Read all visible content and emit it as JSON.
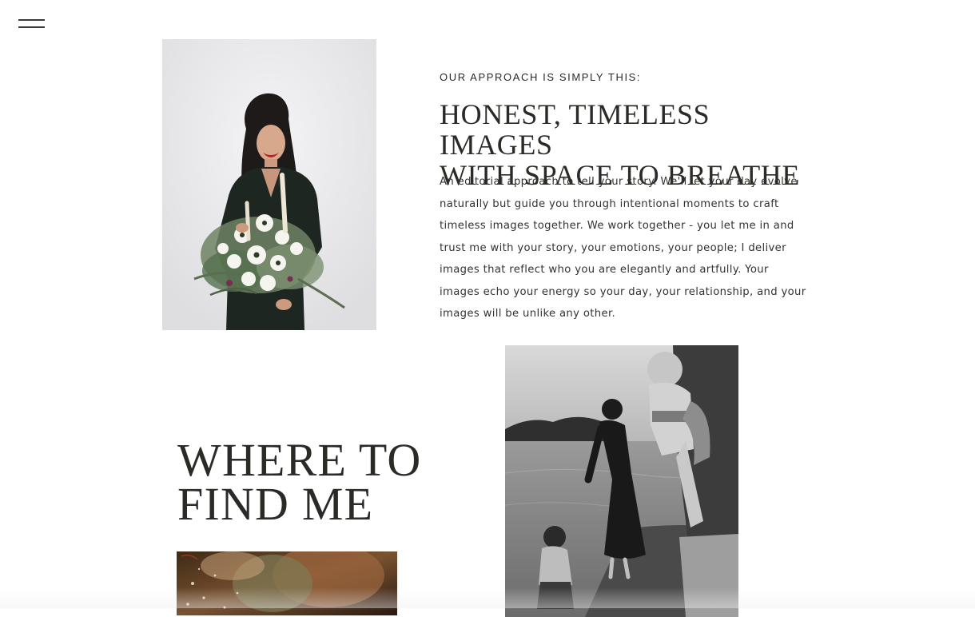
{
  "nav": {
    "menu_icon": "hamburger-menu-icon"
  },
  "approach": {
    "eyebrow": "OUR APPROACH IS SIMPLY THIS:",
    "headline_line1": "HONEST, TIMELESS IMAGES",
    "headline_line2": "WITH SPACE TO BREATHE",
    "body": "An editorial approach to tell your story. We'll let your day evolve naturally but guide you through intentional moments to craft timeless images together. We work together - you let me in and trust me with your story, your emotions, your people; I deliver images that reflect who you are elegantly and artfully. Your images echo your energy so your day, your relationship, and your images will be unlike any other."
  },
  "find_me": {
    "heading_line1": "WHERE TO",
    "heading_line2": "FIND ME"
  },
  "colors": {
    "text": "#2b2a26",
    "background": "#ffffff"
  }
}
